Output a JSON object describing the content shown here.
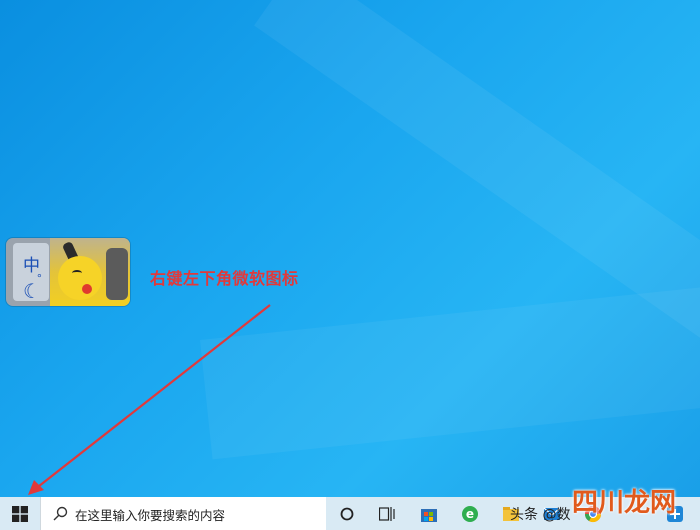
{
  "annotation": {
    "text": "右键左下角微软图标"
  },
  "ime": {
    "chinese_char": "中",
    "dot": "°",
    "moon": "☾"
  },
  "taskbar": {
    "search_placeholder": "在这里输入你要搜索的内容",
    "items": [
      {
        "name": "cortana-icon",
        "glyph": "○"
      },
      {
        "name": "task-view-icon",
        "glyph": "⧉"
      },
      {
        "name": "store-icon",
        "glyph": "🛍"
      },
      {
        "name": "edge-icon",
        "glyph": "e"
      },
      {
        "name": "explorer-icon",
        "glyph": "📁"
      },
      {
        "name": "mail-icon",
        "glyph": "✉"
      },
      {
        "name": "chrome-icon",
        "glyph": "◉"
      },
      {
        "name": "app-icon",
        "glyph": "⊕"
      }
    ]
  },
  "watermark": {
    "text": "头条 @数",
    "logo": "四川龙网"
  },
  "colors": {
    "desktop": "#1aa6ef",
    "taskbar": "#d9eaf4",
    "annotation": "#e1393b"
  }
}
